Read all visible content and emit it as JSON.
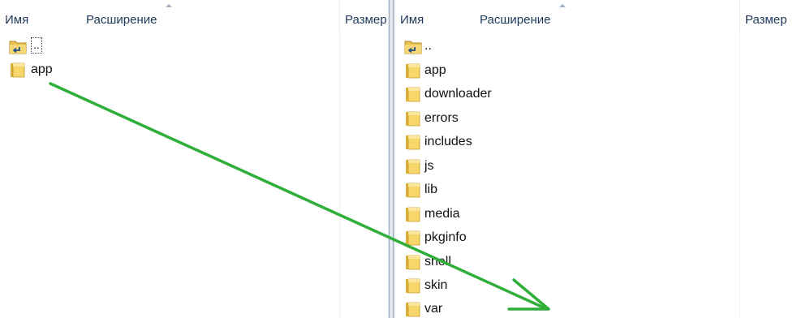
{
  "left_panel": {
    "columns": {
      "name": "Имя",
      "ext": "Расширение",
      "size": "Размер"
    },
    "items": [
      {
        "type": "up",
        "label": ".."
      },
      {
        "type": "folder",
        "label": "app"
      }
    ]
  },
  "right_panel": {
    "columns": {
      "name": "Имя",
      "ext": "Расширение",
      "size": "Размер"
    },
    "items": [
      {
        "type": "up",
        "label": ".."
      },
      {
        "type": "folder",
        "label": "app"
      },
      {
        "type": "folder",
        "label": "downloader"
      },
      {
        "type": "folder",
        "label": "errors"
      },
      {
        "type": "folder",
        "label": "includes"
      },
      {
        "type": "folder",
        "label": "js"
      },
      {
        "type": "folder",
        "label": "lib"
      },
      {
        "type": "folder",
        "label": "media"
      },
      {
        "type": "folder",
        "label": "pkginfo"
      },
      {
        "type": "folder",
        "label": "shell"
      },
      {
        "type": "folder",
        "label": "skin"
      },
      {
        "type": "folder",
        "label": "var"
      }
    ]
  },
  "annotation": {
    "arrow_color": "#2fae3a"
  },
  "icons": {
    "folder": "folder-icon",
    "up": "up-folder-icon"
  }
}
